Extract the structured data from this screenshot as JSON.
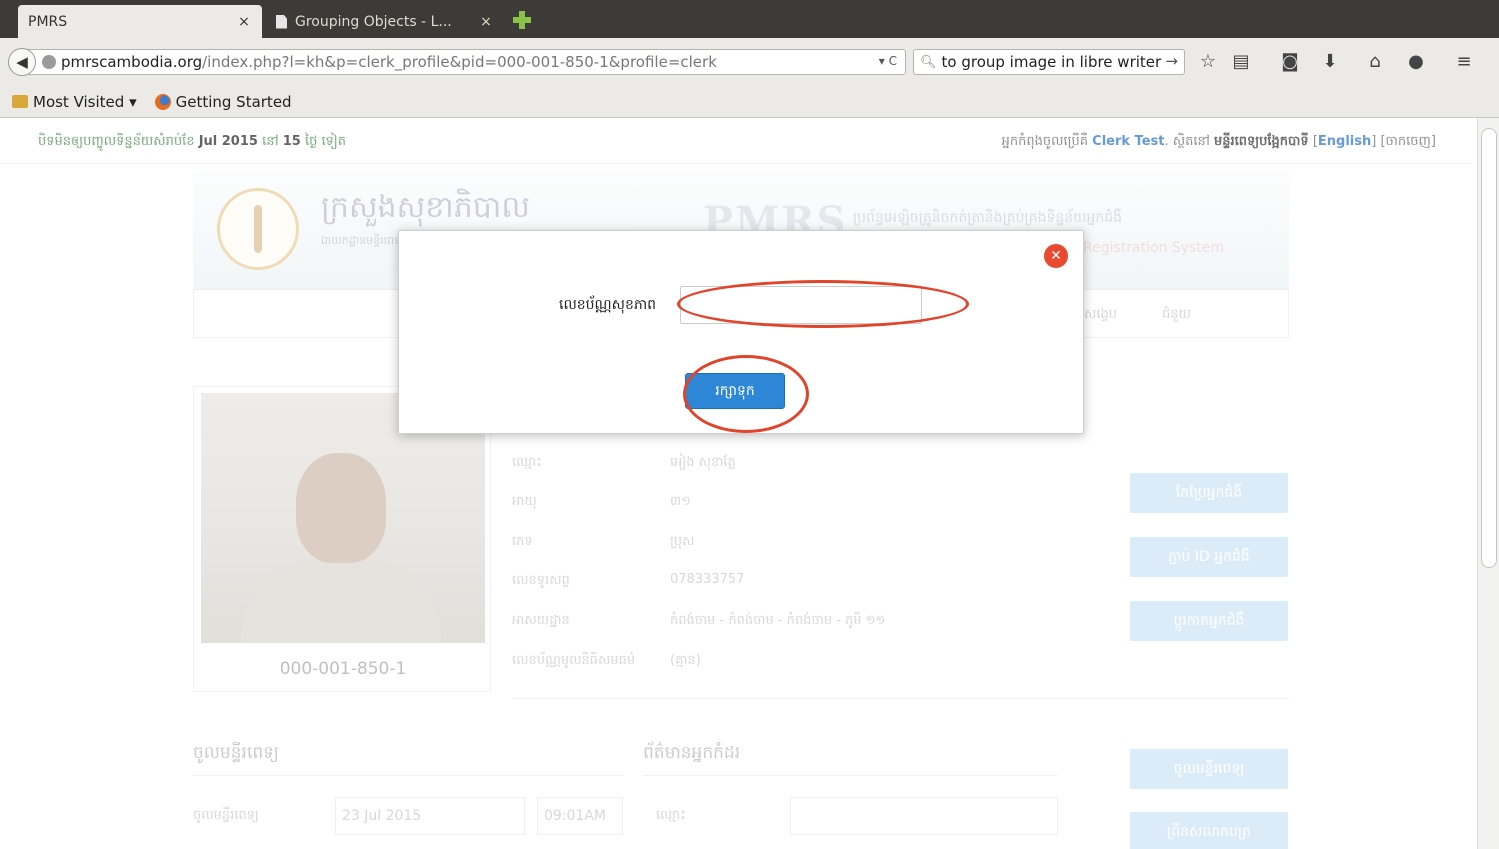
{
  "browser": {
    "tabs": [
      {
        "label": "PMRS",
        "close": "×"
      },
      {
        "label": "Grouping Objects - L...",
        "close": "×"
      }
    ],
    "url_domain": "pmrscambodia.org",
    "url_path": "/index.php?l=kh&p=clerk_profile&pid=000-001-850-1&profile=clerk",
    "url_tools": "▾ C",
    "search_text": "to group image in libre writer",
    "search_go": "→",
    "bookmarks": [
      "Most Visited ▾",
      "Getting Started"
    ]
  },
  "notice": {
    "left_prefix": "បិទមិនឲ្យបញ្ចូលទិន្នន័យសំរាប់ខែ",
    "month": "Jul 2015",
    "left_mid": "នៅ",
    "days": "15",
    "left_suffix": "ថ្ងៃ ទៀត",
    "right_prefix": "អ្នកកំពុងចូលប្រើគឺ",
    "user": "Clerk Test",
    "right_mid": ". ស្ថិតនៅ",
    "hospital": "មន្ទីរពេទ្យបង្អែកបាទី",
    "lang_open": "[",
    "lang": "English",
    "lang_close": "]",
    "logout": "[ចាកចេញ]"
  },
  "header": {
    "ministry": "ក្រសួងសុខាភិបាល",
    "ministry_sub": "ឯាយកដ្ឋានមន្ទីរពេទ្យ",
    "pmrs": "PMRS",
    "tagline": "ប្រព័ន្ធអេឡិចត្រូនិចកត់ត្រានិងគ្រប់គ្រងទិន្នន័យអ្នកជំងឺ",
    "tagline_en": "Registration System"
  },
  "nav": [
    "សង្ខេប",
    "ជំនួយ"
  ],
  "patient": {
    "id": "000-001-850-1",
    "fields": [
      {
        "label": "ឈ្មោះ",
        "value": "អៀង សុខាត្លែ"
      },
      {
        "label": "អាយុ",
        "value": "៣១"
      },
      {
        "label": "ភេទ",
        "value": "ប្រុស"
      },
      {
        "label": "លេខទូរសព្ទ",
        "value": "078333757"
      },
      {
        "label": "អាសយដ្ឋាន",
        "value": "កំពង់ចាម - កំពង់ចាម - កំពង់ចាម - ភូមិ ១១"
      },
      {
        "label": "លេខប័ណ្ណមូលនិធិសមធម៌",
        "value": "(គ្មាន)"
      }
    ]
  },
  "actions": [
    "កែប្រែអ្នកជំងឺ",
    "ភ្ជាប់ ID អ្នកជំងឺ",
    "ប្តូរកាតអ្នកជំងឺ",
    "ចូលមន្ទីរពេទ្យ",
    "ព្រីនសលាកបត្រ"
  ],
  "admission": {
    "title": "ចូលមន្ទីរពេទ្យ",
    "label": "ចូលមន្ទីរពេទ្យ",
    "date": "23 Jul 2015",
    "time": "09:01AM"
  },
  "companion": {
    "title": "ព័ត៌មានអ្នកកំដរ",
    "name_label": "ឈ្មោះ"
  },
  "modal": {
    "close": "✕",
    "label": "លេខប័ណ្ណសុខភាព",
    "input_value": "",
    "save": "រក្សាទុក"
  },
  "colors": {
    "primary_button": "#2d86d6",
    "highlight": "#e0442a",
    "close_icon": "#e8492f"
  }
}
